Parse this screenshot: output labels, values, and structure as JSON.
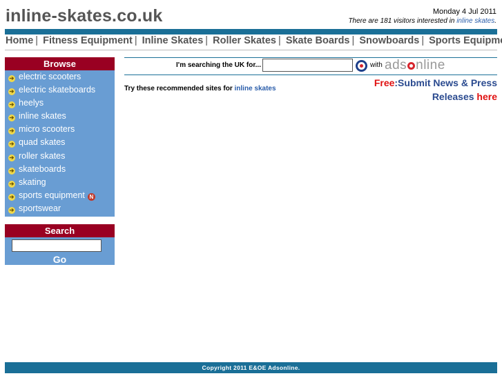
{
  "header": {
    "site_title": "inline-skates.co.uk",
    "date": "Monday 4 Jul 2011",
    "visitors_prefix": "There are 181 visitors interested in ",
    "visitors_keyword": "inline skates",
    "visitors_suffix": "."
  },
  "nav": {
    "items": [
      "Home",
      "Fitness Equipment",
      "Inline Skates",
      "Roller Skates",
      "Skate Boards",
      "Snowboards",
      "Sports Equipment"
    ],
    "separator": "|"
  },
  "browse": {
    "title": "Browse",
    "items": [
      "electric scooters",
      "electric skateboards",
      "heelys",
      "inline skates",
      "micro scooters",
      "quad skates",
      "roller skates",
      "skateboards",
      "skating",
      "sports equipment",
      "sportswear"
    ],
    "new_badge": "N"
  },
  "search_panel": {
    "title": "Search",
    "input_value": "",
    "go_label": "Go"
  },
  "main_search": {
    "label": "I'm searching the UK for...",
    "input_value": "",
    "with_label": "with",
    "brand_prefix": "ads",
    "brand_o": "o",
    "brand_suffix": "nline"
  },
  "recommend": {
    "prefix": "Try these recommended sites for ",
    "keyword": "inline skates"
  },
  "press": {
    "free": "Free",
    "line1": ":Submit News & Press",
    "line2": "Releases ",
    "here": "here"
  },
  "footer": {
    "copyright": "Copyright 2011 E&OE Adsonline."
  },
  "colors": {
    "accent_blue": "#1a6f97",
    "sidebar_blue": "#699dd3",
    "header_red": "#990022",
    "link_blue": "#2a5daa"
  }
}
